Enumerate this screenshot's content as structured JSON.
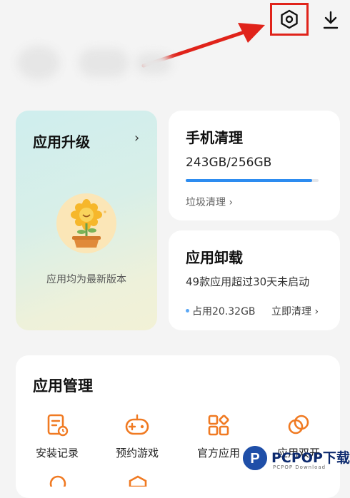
{
  "header": {
    "settings_icon": "hexagon-gear-icon",
    "download_icon": "download-icon",
    "highlight_color": "#e0231a"
  },
  "upgrade_card": {
    "title": "应用升级",
    "chevron": "›",
    "status": "应用均为最新版本"
  },
  "clean_card": {
    "title": "手机清理",
    "storage": "243GB/256GB",
    "used_fraction": 0.949,
    "link": "垃圾清理 ›",
    "accent": "#2d8cf0"
  },
  "uninstall_card": {
    "title": "应用卸载",
    "description": "49款应用超过30天未启动",
    "usage": "占用20.32GB",
    "action": "立即清理 ›"
  },
  "manage_card": {
    "title": "应用管理",
    "tools": [
      {
        "label": "安装记录",
        "icon": "install-record-icon"
      },
      {
        "label": "预约游戏",
        "icon": "gamepad-icon"
      },
      {
        "label": "官方应用",
        "icon": "grid-apps-icon"
      },
      {
        "label": "应用双开",
        "icon": "dual-app-icon"
      }
    ],
    "icon_color": "#f07a22"
  },
  "watermark": {
    "brand": "PCPOP下载",
    "sub": "PCPOP Download"
  }
}
